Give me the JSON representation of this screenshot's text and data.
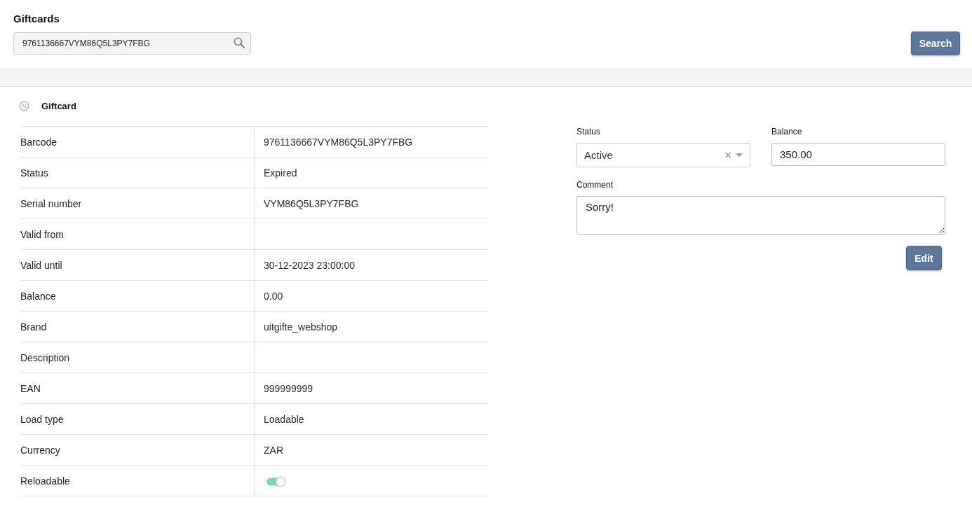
{
  "page": {
    "title": "Giftcards"
  },
  "search": {
    "value": "9761136667VYM86Q5L3PY7FBG",
    "button": "Search"
  },
  "giftcard": {
    "title": "Giftcard",
    "details": [
      {
        "kind": "text",
        "label": "Barcode",
        "value": "9761136667VYM86Q5L3PY7FBG"
      },
      {
        "kind": "text",
        "label": "Status",
        "value": "Expired"
      },
      {
        "kind": "text",
        "label": "Serial number",
        "value": "VYM86Q5L3PY7FBG"
      },
      {
        "kind": "text",
        "label": "Valid from"
      },
      {
        "kind": "text",
        "label": "Valid until",
        "value": "30-12-2023 23:00:00"
      },
      {
        "kind": "text",
        "label": "Balance",
        "value": "0.00"
      },
      {
        "kind": "text",
        "label": "Brand",
        "value": "uitgifte_webshop"
      },
      {
        "kind": "text",
        "label": "Description"
      },
      {
        "kind": "text",
        "label": "EAN",
        "value": "999999999"
      },
      {
        "kind": "text",
        "label": "Load type",
        "value": "Loadable"
      },
      {
        "kind": "text",
        "label": "Currency",
        "value": "ZAR"
      },
      {
        "kind": "toggle",
        "label": "Reloadable",
        "on": true
      }
    ],
    "form": {
      "fields": [
        {
          "kind": "select",
          "label": "Status",
          "value": "Active"
        },
        {
          "kind": "input",
          "label": "Balance",
          "value": "350.00"
        },
        {
          "kind": "textarea",
          "label": "Comment",
          "value": "Sorry!"
        }
      ],
      "button": "Edit"
    }
  }
}
